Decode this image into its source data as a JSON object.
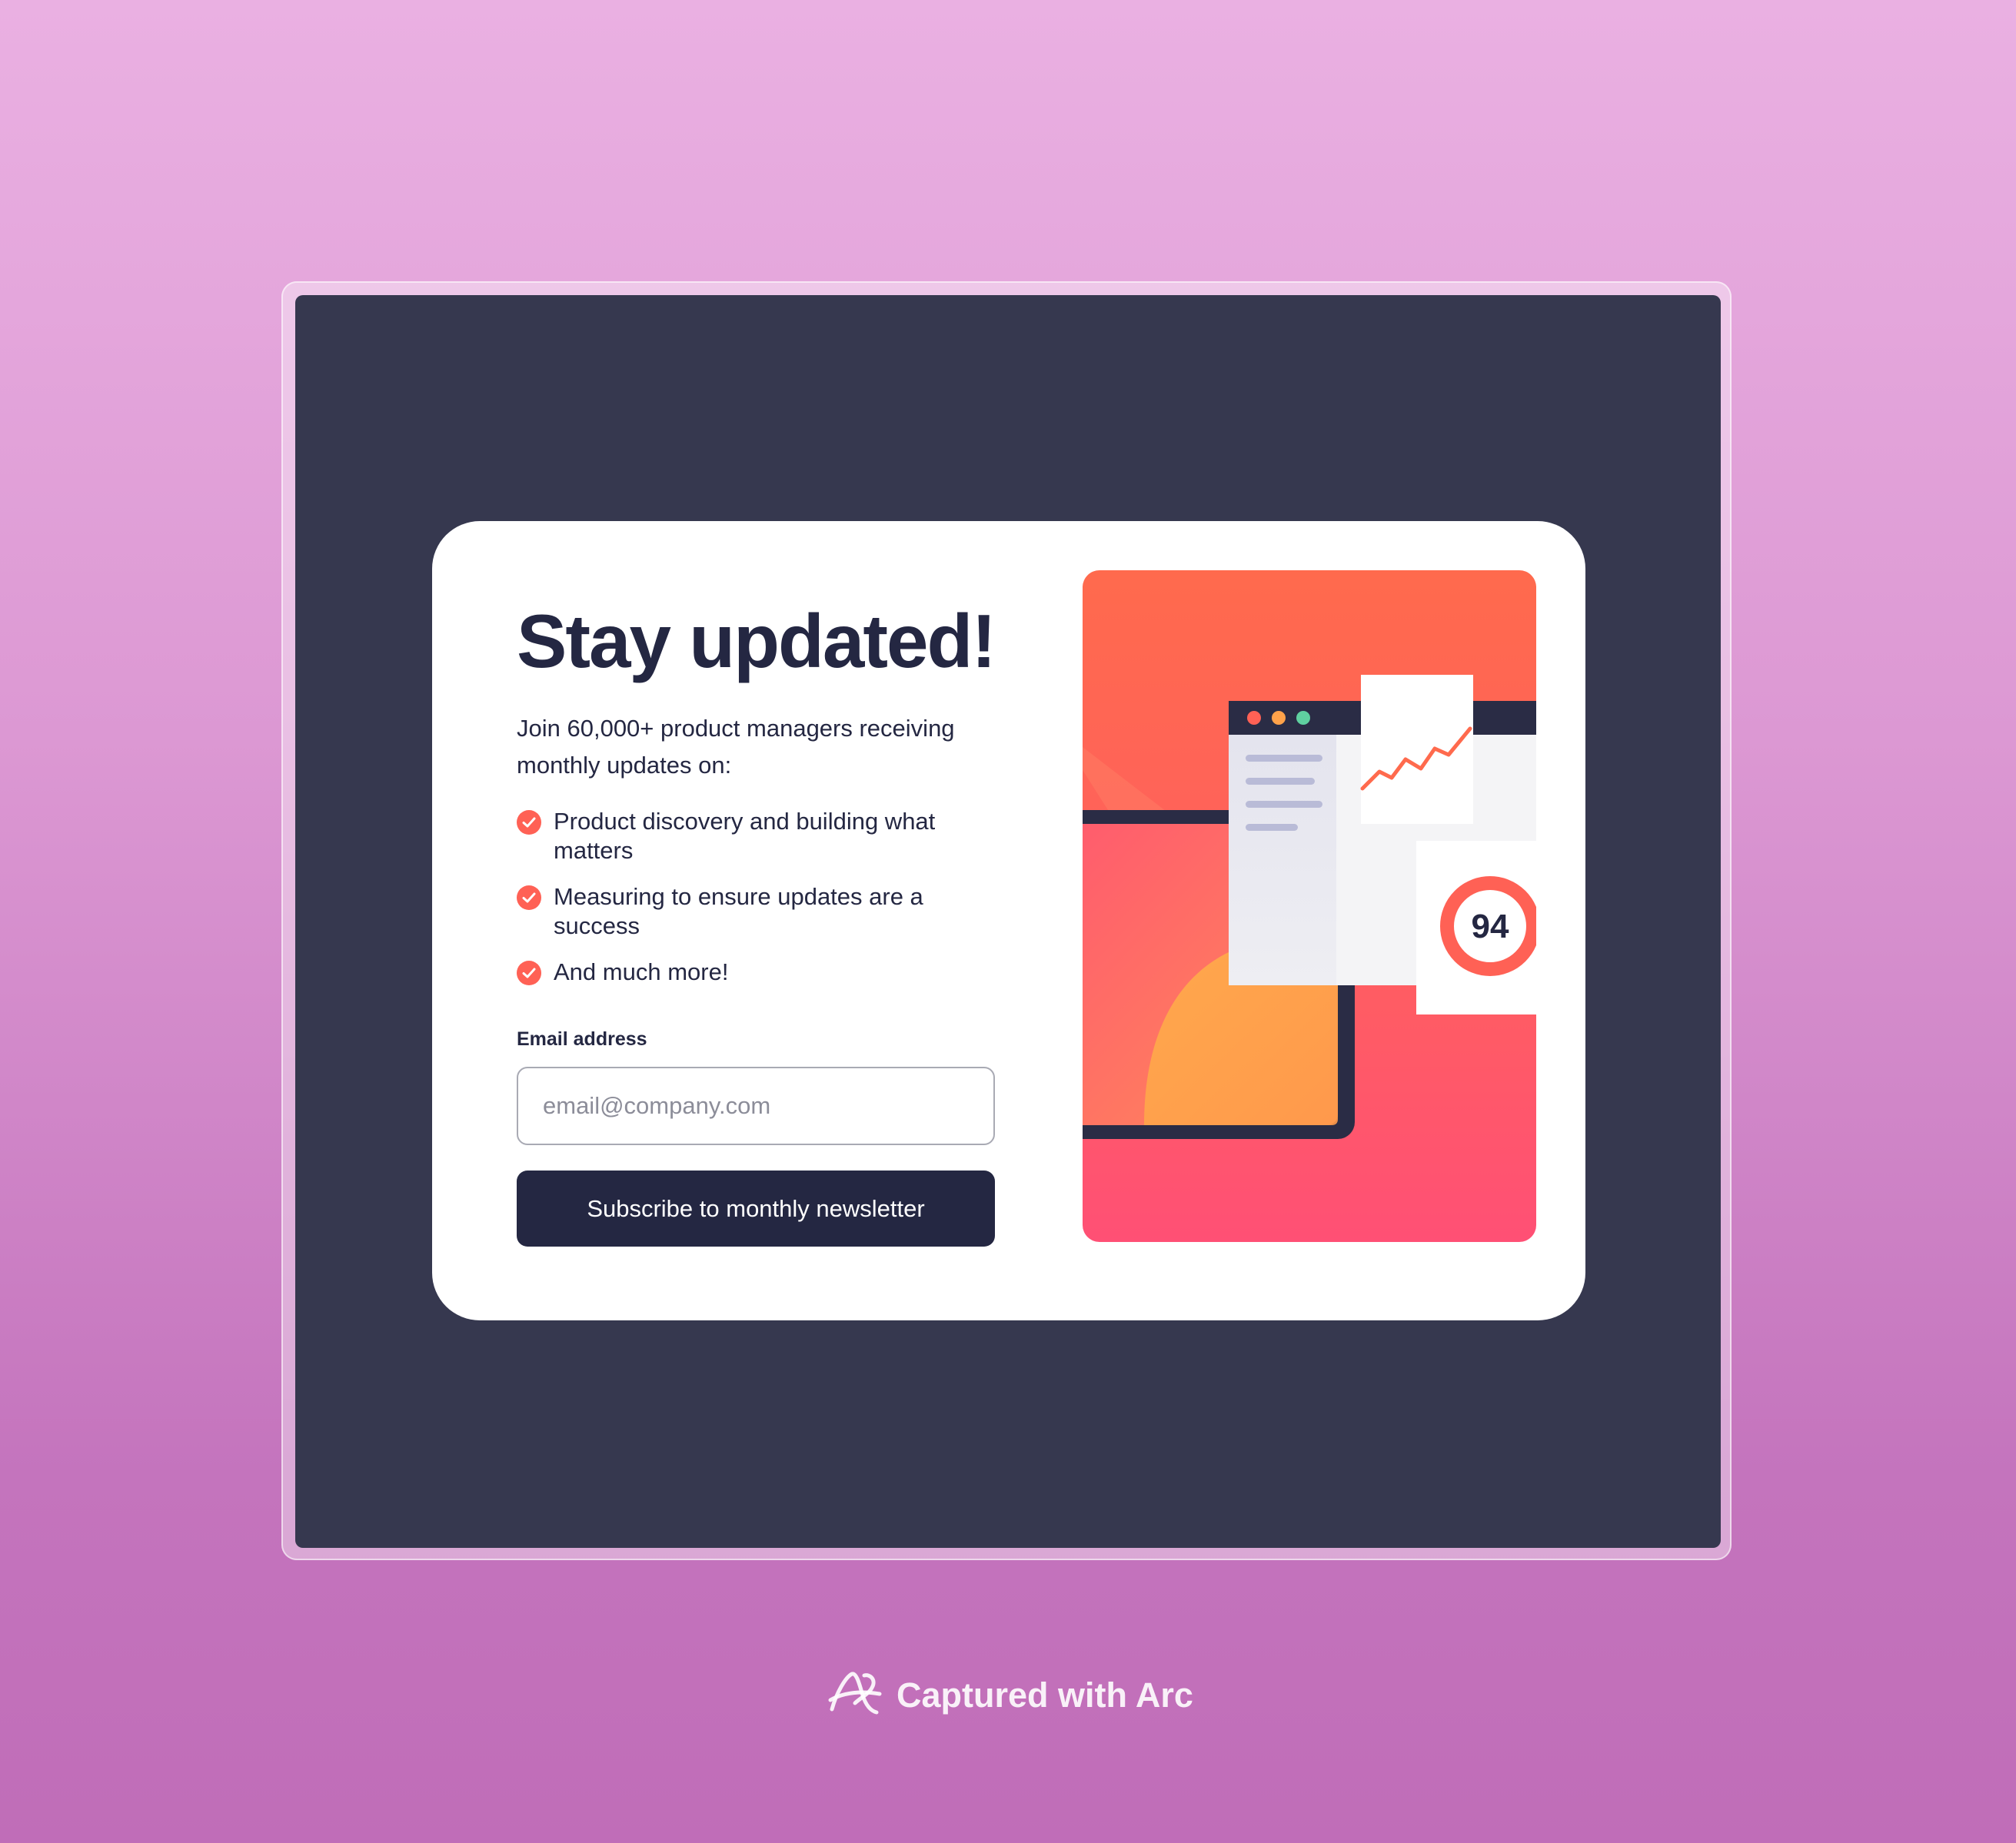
{
  "card": {
    "title": "Stay updated!",
    "intro": "Join 60,000+ product managers receiving monthly updates on:",
    "features": [
      "Product discovery and building what matters",
      "Measuring to ensure updates are a success",
      "And much more!"
    ],
    "email_label": "Email address",
    "email_placeholder": "email@company.com",
    "email_value": "",
    "subscribe_label": "Subscribe to monthly newsletter"
  },
  "illustration": {
    "score": "94",
    "icons": [
      "check-icon",
      "window-dots-icon",
      "trend-line-icon",
      "score-ring-icon"
    ]
  },
  "watermark": {
    "text": "Captured with Arc",
    "icon": "arc-logo-icon"
  },
  "colors": {
    "page_bg_top": "#eab0e2",
    "page_bg_bottom": "#c06db8",
    "viewport_bg": "#36384f",
    "card_bg": "#ffffff",
    "text_dark": "#242742",
    "accent": "#ff6155",
    "button_bg": "#242742",
    "button_text": "#ffffff"
  }
}
